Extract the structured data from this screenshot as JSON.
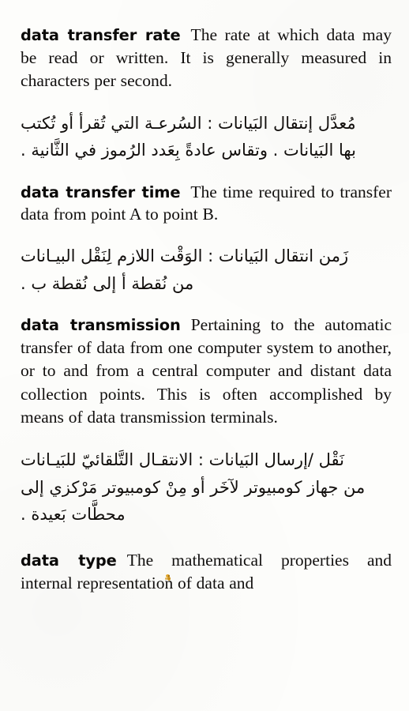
{
  "page": {
    "kind": "bilingual-dictionary-page",
    "background_color": "#fdfdfb",
    "text_color": "#100f0d"
  },
  "entries": [
    {
      "id": "data-transfer-rate",
      "headword": "data transfer rate",
      "english_definition": "The rate at which data may be read or written. It is generally measured in characters per second.",
      "arabic_lines": [
        "مُعدَّل إنتقال البَيانات : السُرعـة التي تُقرأ أو تُكتب",
        "بها البَيانات . وتقاس عادةً بِعَدد الرُموز في الثَّانية ."
      ]
    },
    {
      "id": "data-transfer-time",
      "headword": "data transfer time",
      "english_definition": "The time required to transfer data from point A to point B.",
      "arabic_lines": [
        "زَمن انتقال البَيانات : الوَقْت اللازم لِنَقْل البيـانات",
        "من نُقطة أ إلى نُقطة ب ."
      ]
    },
    {
      "id": "data-transmission",
      "headword": "data transmission",
      "english_definition": "Pertaining to the automatic transfer of data from one computer system to another, or to and from a central computer and distant data collection points. This is often accomplished by means of data transmission terminals.",
      "arabic_lines": [
        "نَقْل /إرسال البَيانات : الانتقـال التَّلقائيّ للبَيـانات",
        "من جهاز كومبيوتر لآخَر أو مِنْ كومبيوتر مَرْكزي إلى",
        "محطَّات بَعيدة ."
      ]
    },
    {
      "id": "data-type",
      "headword": "data type",
      "english_definition": "The mathematical properties and internal representation of data and",
      "arabic_lines": []
    }
  ],
  "artifacts": {
    "speck": {
      "name": "scan-speck",
      "color": "#d79d24"
    }
  }
}
